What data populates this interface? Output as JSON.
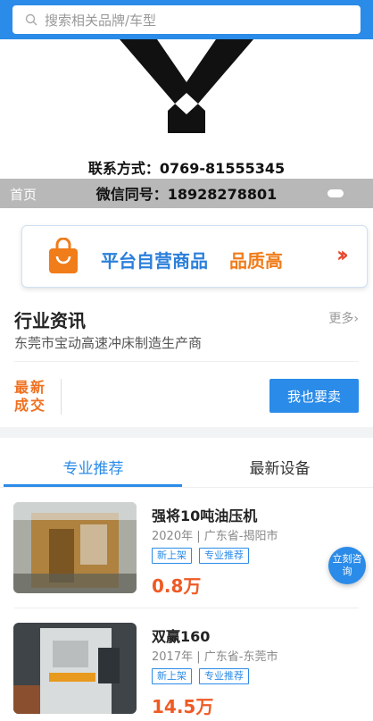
{
  "search": {
    "placeholder": "搜索相关品牌/车型"
  },
  "banner": {
    "contact_phone": "联系方式：0769-81555345",
    "wechat": "微信同号：18928278801",
    "nav_home": "首页"
  },
  "promo": {
    "text_main": "平台自营商品",
    "text_highlight": "品质高",
    "arrow": "››"
  },
  "news": {
    "title": "行业资讯",
    "more": "更多›",
    "subtitle": "东莞市宝动高速冲床制造生产商"
  },
  "deals": {
    "label": "最新成交",
    "sell_button": "我也要卖"
  },
  "tabs": [
    {
      "label": "专业推荐"
    },
    {
      "label": "最新设备"
    }
  ],
  "products": [
    {
      "name": "强将10吨油压机",
      "year": "2020年",
      "location": "广东省-揭阳市",
      "tags": [
        "新上架",
        "专业推荐"
      ],
      "price": "0.8万"
    },
    {
      "name": "双赢160",
      "year": "2017年",
      "location": "广东省-东莞市",
      "tags": [
        "新上架",
        "专业推荐"
      ],
      "price": "14.5万"
    }
  ],
  "consult": {
    "label": "立刻咨询"
  },
  "colors": {
    "primary": "#2b8be8",
    "orange": "#ef7120",
    "price": "#ef5a24"
  }
}
